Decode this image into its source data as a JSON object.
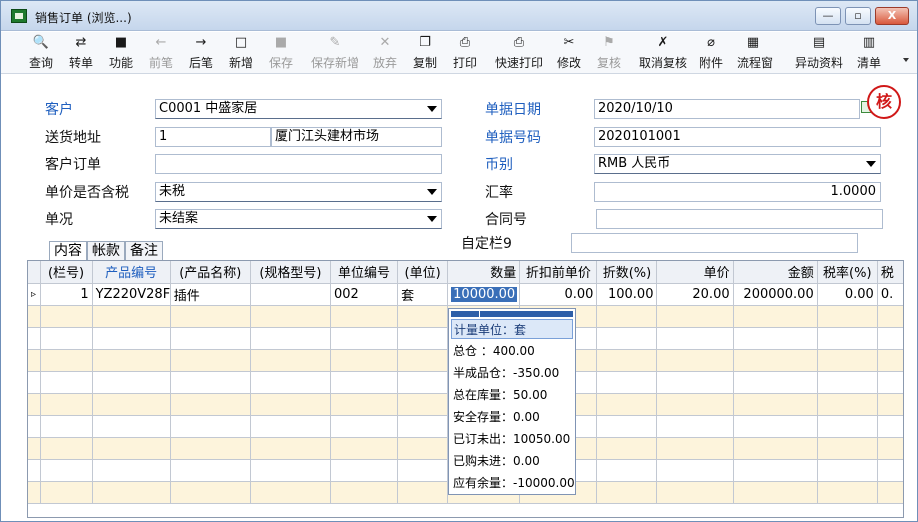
{
  "window": {
    "title": "销售订单 (浏览...)",
    "min_glyph": "—",
    "max_glyph": "▫",
    "close_glyph": "X"
  },
  "toolbar": [
    {
      "key": "query",
      "label": "查询",
      "icon": "🔍",
      "enabled": true
    },
    {
      "key": "transfer",
      "label": "转单",
      "icon": "⇄",
      "enabled": true
    },
    {
      "key": "function",
      "label": "功能",
      "icon": "■",
      "enabled": true
    },
    {
      "key": "prev",
      "label": "前笔",
      "icon": "←",
      "enabled": false
    },
    {
      "key": "next",
      "label": "后笔",
      "icon": "→",
      "enabled": true
    },
    {
      "key": "new",
      "label": "新增",
      "icon": "□",
      "enabled": true
    },
    {
      "key": "save",
      "label": "保存",
      "icon": "■",
      "enabled": false
    },
    {
      "key": "save-new",
      "label": "保存新增",
      "icon": "✎",
      "enabled": false
    },
    {
      "key": "discard",
      "label": "放弃",
      "icon": "✕",
      "enabled": false
    },
    {
      "key": "copy",
      "label": "复制",
      "icon": "❐",
      "enabled": true
    },
    {
      "key": "print",
      "label": "打印",
      "icon": "⎙",
      "enabled": true
    },
    {
      "key": "quick-print",
      "label": "快速打印",
      "icon": "⎙",
      "enabled": true
    },
    {
      "key": "modify",
      "label": "修改",
      "icon": "✂",
      "enabled": true
    },
    {
      "key": "review",
      "label": "复核",
      "icon": "⚑",
      "enabled": false
    },
    {
      "key": "cancel-review",
      "label": "取消复核",
      "icon": "✗",
      "enabled": true
    },
    {
      "key": "attachment",
      "label": "附件",
      "icon": "⌀",
      "enabled": true
    },
    {
      "key": "workflow",
      "label": "流程窗",
      "icon": "▦",
      "enabled": true
    },
    {
      "key": "change-info",
      "label": "异动资料",
      "icon": "▤",
      "enabled": true
    },
    {
      "key": "clear",
      "label": "清单",
      "icon": "▥",
      "enabled": true
    }
  ],
  "form": {
    "customer_label": "客户",
    "customer_value": "C0001 中盛家居",
    "address_label": "送货地址",
    "address_no": "1",
    "address_value": "厦门江头建材市场",
    "customer_order_label": "客户订单",
    "customer_order_value": "",
    "tax_label": "单价是否含税",
    "tax_value": "未税",
    "status_label": "单况",
    "status_value": "未结案",
    "date_label": "单据日期",
    "date_value": "2020/10/10",
    "doc_no_label": "单据号码",
    "doc_no_value": "2020101001",
    "currency_label": "币别",
    "currency_value": "RMB 人民币",
    "rate_label": "汇率",
    "rate_value": "1.0000",
    "contract_label": "合同号",
    "contract_value": "",
    "custom9_label": "自定栏9",
    "custom9_value": "",
    "stamp_text": "核"
  },
  "tabs": [
    {
      "label": "内容",
      "active": true
    },
    {
      "label": "帐款",
      "active": false
    },
    {
      "label": "备注",
      "active": false
    }
  ],
  "grid": {
    "columns": [
      "(栏号)",
      "产品编号",
      "(产品名称)",
      "(规格型号)",
      "单位编号",
      "(单位)",
      "数量",
      "折扣前单价",
      "折数(%)",
      "单价",
      "金额",
      "税率(%)",
      "税"
    ],
    "row_marker": "▹",
    "rows": [
      [
        "1",
        "YZ220V28F",
        "插件",
        "",
        "002",
        "套",
        "10000.00",
        "0.00",
        "100.00",
        "20.00",
        "200000.00",
        "0.00",
        "0."
      ]
    ]
  },
  "popup": {
    "rows": [
      "计量单位：套",
      "总仓      ：400.00",
      "半成品仓：-350.00",
      "总在库量：50.00",
      "安全存量：0.00",
      "已订未出：10050.00",
      "已购未进：0.00",
      "应有余量：-10000.00"
    ]
  }
}
